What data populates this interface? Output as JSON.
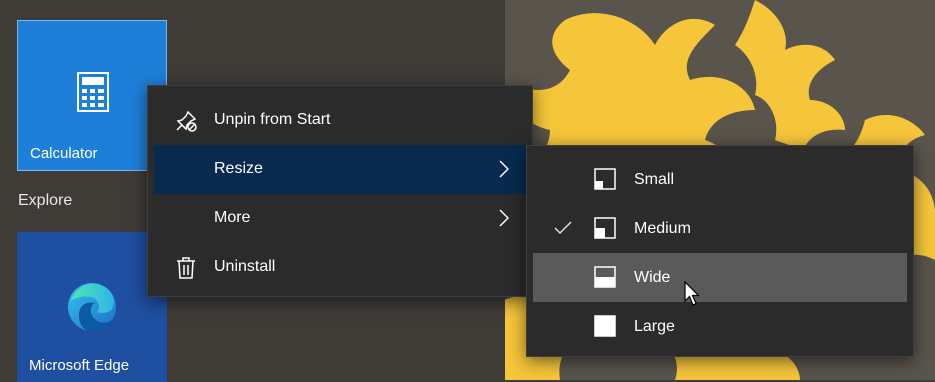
{
  "tiles": {
    "calculator": {
      "label": "Calculator",
      "icon": "calculator-icon",
      "color": "#1e7fd9"
    },
    "edge": {
      "label": "Microsoft Edge",
      "icon": "edge-icon",
      "color": "#1f4fa0"
    }
  },
  "group": {
    "label": "Explore"
  },
  "context_menu": {
    "items": [
      {
        "label": "Unpin from Start",
        "icon": "unpin-icon"
      },
      {
        "label": "Resize",
        "submenu": true,
        "active": true
      },
      {
        "label": "More",
        "submenu": true
      },
      {
        "label": "Uninstall",
        "icon": "trash-icon"
      }
    ]
  },
  "resize_submenu": {
    "items": [
      {
        "label": "Small",
        "icon": "tile-size-small-icon"
      },
      {
        "label": "Medium",
        "icon": "tile-size-medium-icon",
        "checked": true
      },
      {
        "label": "Wide",
        "icon": "tile-size-wide-icon",
        "hovered": true
      },
      {
        "label": "Large",
        "icon": "tile-size-large-icon"
      }
    ]
  },
  "colors": {
    "menu_bg": "#2b2b2b",
    "active_item": "#082a4f",
    "hover_item": "#5a5a5a"
  }
}
